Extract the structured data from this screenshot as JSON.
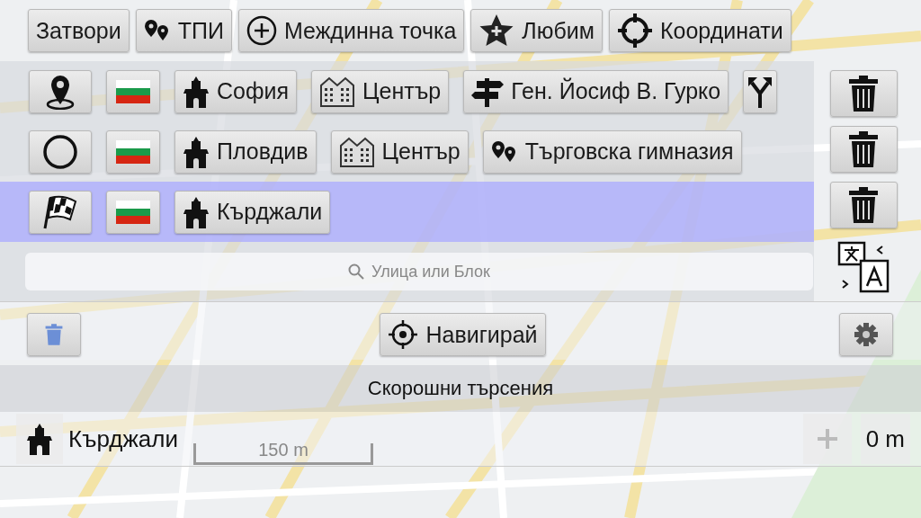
{
  "toolbar": [
    {
      "kind": "text",
      "label": "Затвори"
    },
    {
      "kind": "poi",
      "label": "ТПИ"
    },
    {
      "kind": "add",
      "label": "Междинна точка"
    },
    {
      "kind": "favorite",
      "label": "Любим"
    },
    {
      "kind": "target",
      "label": "Координати"
    }
  ],
  "route": [
    {
      "kind": "start",
      "selected": false,
      "turn_button": true,
      "parts": [
        {
          "kind": "town",
          "label": "София"
        },
        {
          "kind": "district",
          "label": "Център"
        },
        {
          "kind": "street",
          "label": "Ген. Йосиф В. Гурко"
        }
      ]
    },
    {
      "kind": "via",
      "selected": false,
      "turn_button": false,
      "parts": [
        {
          "kind": "town",
          "label": "Пловдив"
        },
        {
          "kind": "district",
          "label": "Център"
        },
        {
          "kind": "poi",
          "label": "Търговска гимназия"
        }
      ]
    },
    {
      "kind": "finish",
      "selected": true,
      "turn_button": false,
      "parts": [
        {
          "kind": "town",
          "label": "Кърджали"
        }
      ]
    }
  ],
  "search": {
    "placeholder": "Улица или Блок"
  },
  "navigate": {
    "label": "Навигирай"
  },
  "recent": {
    "title": "Скорошни търсения",
    "items": [
      {
        "kind": "town",
        "label": "Кърджали",
        "distance": "0 m"
      }
    ]
  },
  "scale_bar": {
    "label": "150 m"
  }
}
